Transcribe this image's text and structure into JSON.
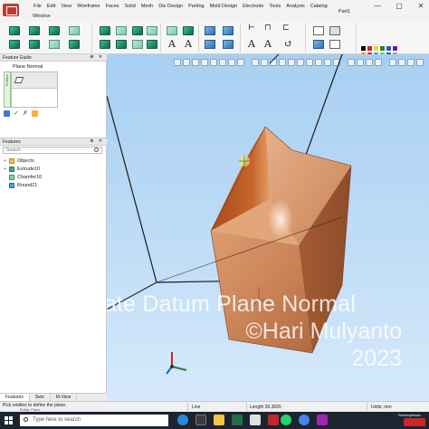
{
  "menubar": {
    "items": [
      "File",
      "Edit",
      "View",
      "Wireframe",
      "Faces",
      "Solid",
      "Mesh",
      "Die Design",
      "Parting",
      "Mold Design",
      "Electrode",
      "Tools",
      "Analysis",
      "Catalog"
    ],
    "second_row": "Window",
    "document_title": "Part1"
  },
  "window_controls": {
    "minimize": "—",
    "restore": "▢",
    "close": "✕"
  },
  "feature_guide": {
    "title": "Feature Guide",
    "command": "Plane Normal",
    "ok_symbol": "✓",
    "cancel_symbol": "✗"
  },
  "features": {
    "title": "Features",
    "search_placeholder": "Search",
    "tree": [
      {
        "label": "Objects",
        "icon": "objects-icon"
      },
      {
        "label": "Extrude10",
        "icon": "extrude-icon"
      },
      {
        "label": "Chamfer10",
        "icon": "chamfer-icon"
      },
      {
        "label": "Round21",
        "icon": "round-icon"
      }
    ]
  },
  "bottom_tabs": [
    "Features",
    "Sets",
    "M-View"
  ],
  "statusbar": {
    "message": "Pick entities to define the plane.",
    "sub_message": "Entity: Plane",
    "line_label": "Line",
    "length_label": "Length 36.3665",
    "units_label": "Units: mm"
  },
  "watermark": {
    "line1": "Create Datum Plane Normal",
    "line2": "©Hari Mulyanto",
    "line3": "2023"
  },
  "taskbar": {
    "search_text": "Type here to search",
    "tray_label": "Screenpresso"
  },
  "colors": {
    "viewport_sky_top": "#a8cff2",
    "model_copper": "#d08a5c",
    "highlight_face": "#a8461a",
    "selection_yellow": "#f2e27a"
  }
}
